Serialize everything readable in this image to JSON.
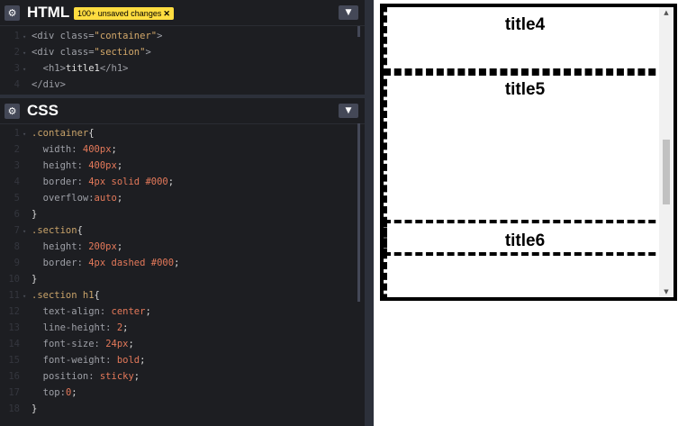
{
  "html_panel": {
    "title": "HTML",
    "badge": "100+ unsaved changes",
    "badge_close": "✕",
    "settings_icon": "gear-icon",
    "collapse_icon": "chevron-down-icon",
    "lines": [
      {
        "n": "1",
        "parts": [
          [
            "tag",
            "<div "
          ],
          [
            "attr",
            "class="
          ],
          [
            "val",
            "\"container\""
          ],
          [
            "tag",
            ">"
          ]
        ]
      },
      {
        "n": "2",
        "parts": [
          [
            "tag",
            "<div "
          ],
          [
            "attr",
            "class="
          ],
          [
            "val",
            "\"section\""
          ],
          [
            "tag",
            ">"
          ]
        ]
      },
      {
        "n": "3",
        "parts": [
          [
            "tag",
            "  <h1>"
          ],
          [
            "txt",
            "title1"
          ],
          [
            "tag",
            "</h1>"
          ]
        ]
      },
      {
        "n": "4",
        "parts": [
          [
            "tag",
            "</div>"
          ]
        ]
      }
    ]
  },
  "css_panel": {
    "title": "CSS",
    "settings_icon": "gear-icon",
    "collapse_icon": "chevron-down-icon",
    "lines": [
      {
        "n": "1",
        "parts": [
          [
            "sel",
            ".container"
          ],
          [
            "punct",
            "{"
          ]
        ]
      },
      {
        "n": "2",
        "parts": [
          [
            "prop",
            "  width: "
          ],
          [
            "num",
            "400px"
          ],
          [
            "punct",
            ";"
          ]
        ]
      },
      {
        "n": "3",
        "parts": [
          [
            "prop",
            "  height: "
          ],
          [
            "num",
            "400px"
          ],
          [
            "punct",
            ";"
          ]
        ]
      },
      {
        "n": "4",
        "parts": [
          [
            "prop",
            "  border: "
          ],
          [
            "num",
            "4px"
          ],
          [
            "kw",
            " solid "
          ],
          [
            "num",
            "#000"
          ],
          [
            "punct",
            ";"
          ]
        ]
      },
      {
        "n": "5",
        "parts": [
          [
            "prop",
            "  overflow:"
          ],
          [
            "kw",
            "auto"
          ],
          [
            "punct",
            ";"
          ]
        ]
      },
      {
        "n": "6",
        "parts": [
          [
            "punct",
            "}"
          ]
        ]
      },
      {
        "n": "7",
        "parts": [
          [
            "sel",
            ".section"
          ],
          [
            "punct",
            "{"
          ]
        ]
      },
      {
        "n": "8",
        "parts": [
          [
            "prop",
            "  height: "
          ],
          [
            "num",
            "200px"
          ],
          [
            "punct",
            ";"
          ]
        ]
      },
      {
        "n": "9",
        "parts": [
          [
            "prop",
            "  border: "
          ],
          [
            "num",
            "4px"
          ],
          [
            "kw",
            " dashed "
          ],
          [
            "num",
            "#000"
          ],
          [
            "punct",
            ";"
          ]
        ]
      },
      {
        "n": "10",
        "parts": [
          [
            "punct",
            "}"
          ]
        ]
      },
      {
        "n": "11",
        "parts": [
          [
            "sel",
            ".section h1"
          ],
          [
            "punct",
            "{"
          ]
        ]
      },
      {
        "n": "12",
        "parts": [
          [
            "prop",
            "  text-align: "
          ],
          [
            "kw",
            "center"
          ],
          [
            "punct",
            ";"
          ]
        ]
      },
      {
        "n": "13",
        "parts": [
          [
            "prop",
            "  line-height: "
          ],
          [
            "num",
            "2"
          ],
          [
            "punct",
            ";"
          ]
        ]
      },
      {
        "n": "14",
        "parts": [
          [
            "prop",
            "  font-size: "
          ],
          [
            "num",
            "24px"
          ],
          [
            "punct",
            ";"
          ]
        ]
      },
      {
        "n": "15",
        "parts": [
          [
            "prop",
            "  font-weight: "
          ],
          [
            "kw",
            "bold"
          ],
          [
            "punct",
            ";"
          ]
        ]
      },
      {
        "n": "16",
        "parts": [
          [
            "prop",
            "  position: "
          ],
          [
            "kw",
            "sticky"
          ],
          [
            "punct",
            ";"
          ]
        ]
      },
      {
        "n": "17",
        "parts": [
          [
            "prop",
            "  top:"
          ],
          [
            "num",
            "0"
          ],
          [
            "punct",
            ";"
          ]
        ]
      },
      {
        "n": "18",
        "parts": [
          [
            "punct",
            "}"
          ]
        ]
      }
    ]
  },
  "preview": {
    "sections": [
      {
        "title": "title4"
      },
      {
        "title": "title5"
      },
      {
        "title": "title6"
      }
    ],
    "scroll_up_icon": "arrow-up-icon",
    "scroll_down_icon": "arrow-down-icon"
  },
  "colors": {
    "editor_bg": "#1d1e22",
    "badge_bg": "#ffdd40",
    "button_bg": "#444857"
  }
}
